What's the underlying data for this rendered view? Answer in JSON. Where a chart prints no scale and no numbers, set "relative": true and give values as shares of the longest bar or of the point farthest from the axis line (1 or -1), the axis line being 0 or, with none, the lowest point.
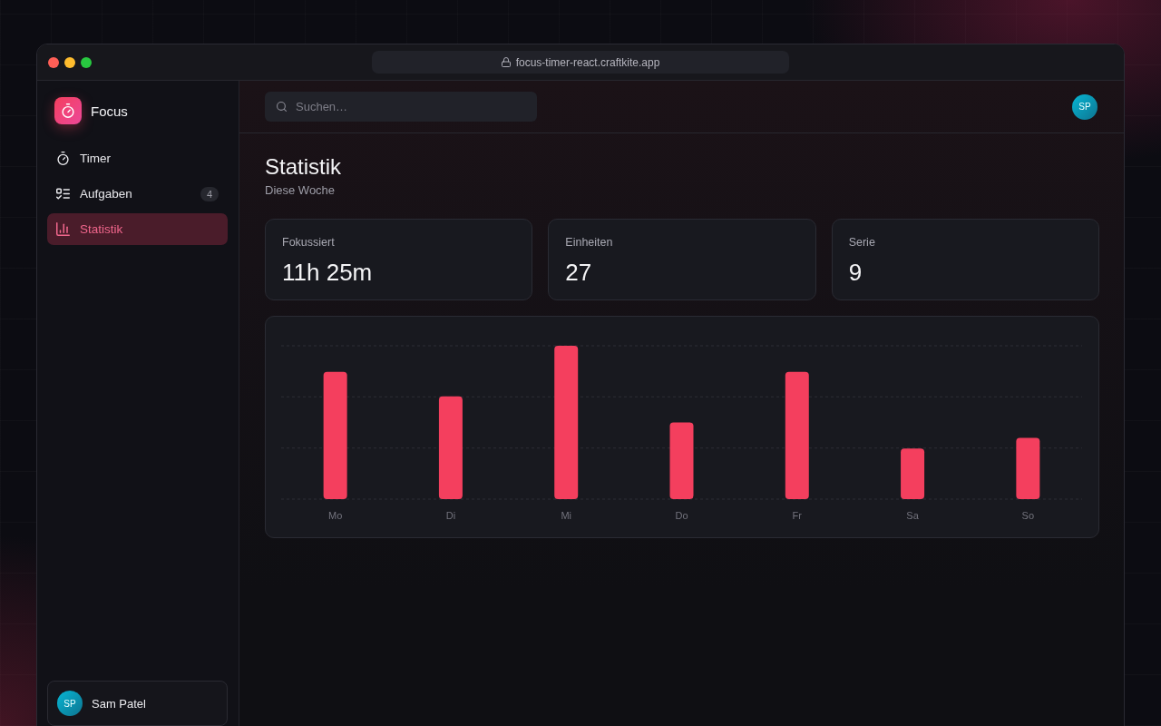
{
  "browser": {
    "url": "focus-timer-react.craftkite.app"
  },
  "app": {
    "name": "Focus"
  },
  "sidebar": {
    "items": [
      {
        "label": "Timer",
        "selected": false
      },
      {
        "label": "Aufgaben",
        "badge": "4",
        "selected": false
      },
      {
        "label": "Statistik",
        "selected": true
      }
    ],
    "user": {
      "initials": "SP",
      "name": "Sam Patel"
    }
  },
  "header": {
    "search": {
      "placeholder": "Suchen…"
    },
    "avatar": {
      "initials": "SP"
    }
  },
  "page": {
    "title": "Statistik",
    "subtitle": "Diese Woche"
  },
  "stats": [
    {
      "label": "Fokussiert",
      "value": "11h 25m"
    },
    {
      "label": "Einheiten",
      "value": "27"
    },
    {
      "label": "Serie",
      "value": "9"
    }
  ],
  "chart": {
    "chart_data": {
      "type": "bar",
      "relative": true,
      "categories": [
        "Mo",
        "Di",
        "Mi",
        "Do",
        "Fr",
        "Sa",
        "So"
      ],
      "values": [
        0.83,
        0.67,
        1,
        0.5,
        0.83,
        0.33,
        0.4
      ],
      "ref_lines": [
        {
          "axis": "y",
          "value": 0.333
        },
        {
          "axis": "y",
          "value": 0.667
        }
      ]
    }
  }
}
